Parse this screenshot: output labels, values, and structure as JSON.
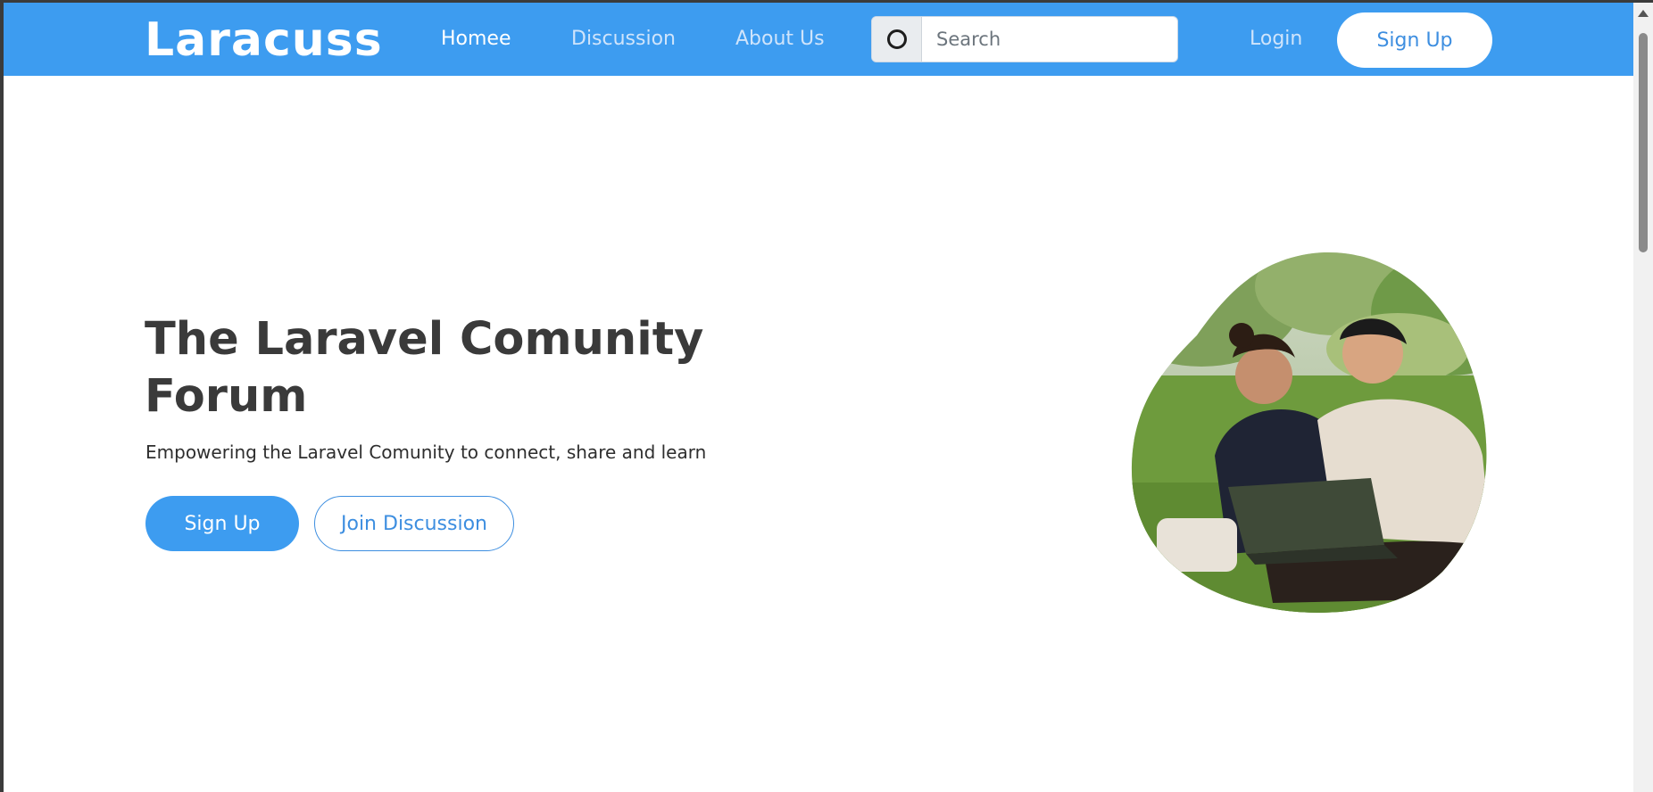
{
  "navbar": {
    "brand": "Laracuss",
    "links": [
      {
        "label": "Homee",
        "active": true
      },
      {
        "label": "Discussion",
        "active": false
      },
      {
        "label": "About Us",
        "active": false
      }
    ],
    "search": {
      "placeholder": "Search",
      "value": ""
    },
    "login_label": "Login",
    "signup_label": "Sign Up"
  },
  "hero": {
    "title": "The Laravel Comunity Forum",
    "subtitle": "Empowering the Laravel Comunity to connect, share and learn",
    "primary_button": "Sign Up",
    "secondary_button": "Join Discussion"
  },
  "colors": {
    "brand_blue": "#3d9cf0",
    "heading": "#3a3a3a",
    "nav_inactive": "#cfe4fb"
  },
  "icons": {
    "search": "search-icon"
  }
}
